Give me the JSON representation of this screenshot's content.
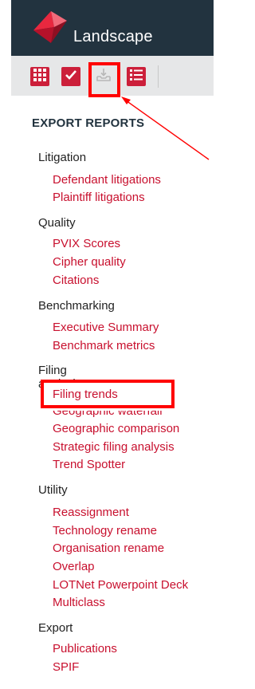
{
  "app": {
    "title": "Landscape"
  },
  "toolbar": {
    "buttons": [
      {
        "icon": "grid-icon"
      },
      {
        "icon": "checkmark-icon"
      },
      {
        "icon": "download-tray-icon"
      },
      {
        "icon": "list-icon"
      }
    ]
  },
  "export": {
    "title": "EXPORT REPORTS",
    "groups": [
      {
        "label": "Litigation",
        "items": [
          "Defendant litigations",
          "Plaintiff litigations"
        ]
      },
      {
        "label": "Quality",
        "items": [
          "PVIX Scores",
          "Cipher quality",
          "Citations"
        ]
      },
      {
        "label": "Benchmarking",
        "items": [
          "Executive Summary",
          "Benchmark metrics"
        ]
      },
      {
        "label": "Filing analysis",
        "items": [
          "Filing trends",
          "Geographic waterfall",
          "Geographic comparison",
          "Strategic filing analysis",
          "Trend Spotter"
        ]
      },
      {
        "label": "Utility",
        "items": [
          "Reassignment",
          "Technology rename",
          "Organisation rename",
          "Overlap",
          "LOTNet Powerpoint Deck",
          "Multiclass"
        ]
      },
      {
        "label": "Export",
        "items": [
          "Publications",
          "SPIF"
        ]
      }
    ]
  },
  "colors": {
    "header_bg": "#22333f",
    "accent": "#cc1f3a",
    "link": "#c8102e",
    "annotation": "#ff0000"
  }
}
